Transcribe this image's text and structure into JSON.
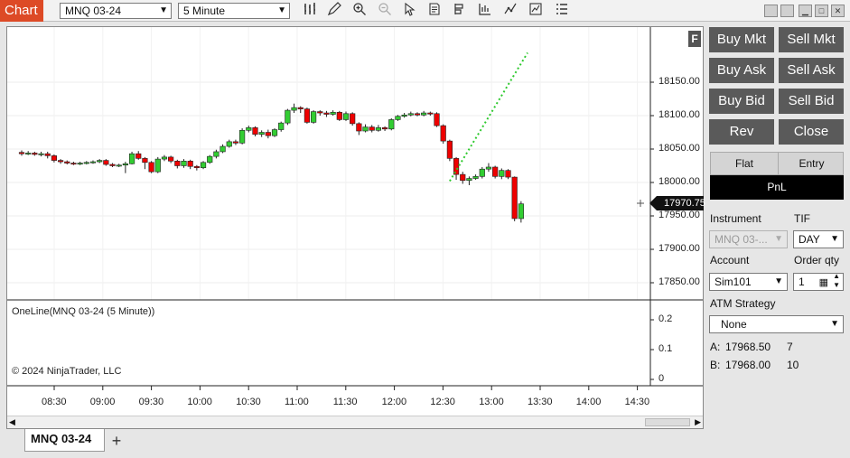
{
  "toolbar": {
    "app_label": "Chart",
    "instrument": "MNQ 03-24",
    "interval": "5 Minute",
    "icons": [
      "bar-type-icon",
      "draw-pencil-icon",
      "zoom-in-icon",
      "zoom-out-icon",
      "pointer-icon",
      "data-box-icon",
      "strategies-icon",
      "indicators-icon",
      "trend-icon",
      "chart-trader-icon",
      "properties-icon"
    ]
  },
  "window_controls": [
    "window-tile-icon",
    "window-tile2-icon",
    "minimize-icon",
    "maximize-icon",
    "close-icon"
  ],
  "chart": {
    "f_button": "F",
    "current_price": "17970.75",
    "y_labels": [
      "18150.00",
      "18100.00",
      "18050.00",
      "18000.00",
      "17950.00",
      "17900.00",
      "17850.00"
    ],
    "x_labels": [
      "08:30",
      "09:00",
      "09:30",
      "10:00",
      "10:30",
      "11:00",
      "11:30",
      "12:00",
      "12:30",
      "13:00",
      "13:30",
      "14:00",
      "14:30"
    ],
    "indicator_label": "OneLine(MNQ 03-24 (5 Minute))",
    "indicator_y_labels": [
      "0.2",
      "0.1",
      "0"
    ],
    "copyright": "© 2024 NinjaTrader, LLC",
    "colors": {
      "up": "#32cd32",
      "down": "#ee0000",
      "trendline": "#2ec92e"
    }
  },
  "chart_data": {
    "type": "candlestick",
    "ylim": [
      17820,
      18210
    ],
    "candles": [
      [
        18045,
        18043,
        18048,
        18040
      ],
      [
        18043,
        18044,
        18047,
        18041
      ],
      [
        18044,
        18042,
        18046,
        18040
      ],
      [
        18042,
        18043,
        18046,
        18039
      ],
      [
        18043,
        18040,
        18046,
        18036
      ],
      [
        18040,
        18033,
        18042,
        18030
      ],
      [
        18033,
        18031,
        18035,
        18028
      ],
      [
        18031,
        18029,
        18033,
        18027
      ],
      [
        18029,
        18028,
        18031,
        18026
      ],
      [
        18028,
        18029,
        18031,
        18026
      ],
      [
        18029,
        18030,
        18032,
        18027
      ],
      [
        18030,
        18031,
        18033,
        18028
      ],
      [
        18031,
        18033,
        18035,
        18029
      ],
      [
        18033,
        18027,
        18035,
        18025
      ],
      [
        18027,
        18025,
        18029,
        18023
      ],
      [
        18025,
        18026,
        18028,
        18023
      ],
      [
        18026,
        18028,
        18031,
        18014
      ],
      [
        18028,
        18043,
        18046,
        18027
      ],
      [
        18043,
        18036,
        18047,
        18034
      ],
      [
        18036,
        18030,
        18038,
        18020
      ],
      [
        18030,
        18016,
        18032,
        18014
      ],
      [
        18016,
        18035,
        18038,
        18014
      ],
      [
        18035,
        18038,
        18041,
        18032
      ],
      [
        18038,
        18032,
        18040,
        18029
      ],
      [
        18032,
        18025,
        18034,
        18021
      ],
      [
        18025,
        18032,
        18035,
        18022
      ],
      [
        18032,
        18024,
        18034,
        18020
      ],
      [
        18024,
        18022,
        18026,
        18018
      ],
      [
        18022,
        18030,
        18032,
        18020
      ],
      [
        18030,
        18039,
        18041,
        18028
      ],
      [
        18039,
        18046,
        18049,
        18036
      ],
      [
        18046,
        18054,
        18057,
        18044
      ],
      [
        18054,
        18061,
        18064,
        18052
      ],
      [
        18061,
        18059,
        18064,
        18056
      ],
      [
        18059,
        18078,
        18081,
        18057
      ],
      [
        18078,
        18082,
        18085,
        18075
      ],
      [
        18082,
        18072,
        18084,
        18069
      ],
      [
        18072,
        18075,
        18078,
        18068
      ],
      [
        18075,
        18070,
        18079,
        18066
      ],
      [
        18070,
        18079,
        18081,
        18068
      ],
      [
        18079,
        18089,
        18091,
        18076
      ],
      [
        18089,
        18108,
        18110,
        18086
      ],
      [
        18108,
        18112,
        18118,
        18104
      ],
      [
        18112,
        18110,
        18114,
        18104
      ],
      [
        18110,
        18090,
        18112,
        18088
      ],
      [
        18090,
        18106,
        18108,
        18088
      ],
      [
        18106,
        18104,
        18108,
        18100
      ],
      [
        18104,
        18102,
        18107,
        18098
      ],
      [
        18102,
        18105,
        18108,
        18100
      ],
      [
        18105,
        18094,
        18107,
        18092
      ],
      [
        18094,
        18103,
        18106,
        18092
      ],
      [
        18103,
        18088,
        18105,
        18085
      ],
      [
        18088,
        18077,
        18090,
        18071
      ],
      [
        18077,
        18083,
        18087,
        18075
      ],
      [
        18083,
        18078,
        18086,
        18075
      ],
      [
        18078,
        18082,
        18086,
        18076
      ],
      [
        18082,
        18080,
        18084,
        18077
      ],
      [
        18080,
        18094,
        18096,
        18078
      ],
      [
        18094,
        18099,
        18101,
        18092
      ],
      [
        18099,
        18101,
        18104,
        18097
      ],
      [
        18101,
        18103,
        18106,
        18099
      ],
      [
        18103,
        18101,
        18105,
        18099
      ],
      [
        18101,
        18104,
        18107,
        18099
      ],
      [
        18104,
        18103,
        18106,
        18100
      ],
      [
        18103,
        18085,
        18105,
        18083
      ],
      [
        18085,
        18062,
        18087,
        18058
      ],
      [
        18062,
        18036,
        18064,
        18032
      ],
      [
        18036,
        18012,
        18038,
        18004
      ],
      [
        18012,
        18003,
        18016,
        17998
      ],
      [
        18003,
        18006,
        18009,
        17996
      ],
      [
        18006,
        18009,
        18012,
        18004
      ],
      [
        18009,
        18020,
        18023,
        18006
      ],
      [
        18020,
        18023,
        18029,
        18016
      ],
      [
        18023,
        18009,
        18025,
        18006
      ],
      [
        18009,
        18018,
        18021,
        18005
      ],
      [
        18018,
        18008,
        18020,
        18005
      ],
      [
        18008,
        17946,
        18009,
        17942
      ],
      [
        17946,
        17968,
        17972,
        17940
      ]
    ],
    "trendline": [
      [
        66,
        18002
      ],
      [
        78,
        18194
      ]
    ]
  },
  "trader": {
    "buttons": [
      {
        "name": "buy-mkt-button",
        "label": "Buy Mkt"
      },
      {
        "name": "sell-mkt-button",
        "label": "Sell Mkt"
      },
      {
        "name": "buy-ask-button",
        "label": "Buy Ask"
      },
      {
        "name": "sell-ask-button",
        "label": "Sell Ask"
      },
      {
        "name": "buy-bid-button",
        "label": "Buy Bid"
      },
      {
        "name": "sell-bid-button",
        "label": "Sell Bid"
      },
      {
        "name": "reverse-button",
        "label": "Rev"
      },
      {
        "name": "close-button",
        "label": "Close"
      }
    ],
    "flat_label": "Flat",
    "entry_label": "Entry",
    "pnl_label": "PnL",
    "instrument_label": "Instrument",
    "instrument_value": "MNQ 03-...",
    "tif_label": "TIF",
    "tif_value": "DAY",
    "account_label": "Account",
    "account_value": "Sim101",
    "order_qty_label": "Order qty",
    "order_qty_value": "1",
    "atm_label": "ATM Strategy",
    "atm_value": "None",
    "ask_label": "A:",
    "ask_price": "17968.50",
    "ask_size": "7",
    "bid_label": "B:",
    "bid_price": "17968.00",
    "bid_size": "10"
  },
  "tabs": {
    "active": "MNQ 03-24",
    "add": "+"
  }
}
